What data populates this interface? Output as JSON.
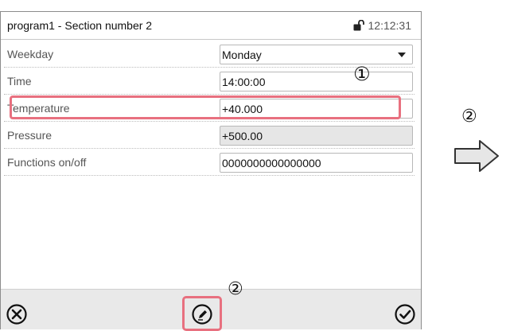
{
  "header": {
    "title": "program1 - Section number 2",
    "time": "12:12:31",
    "icons": [
      "lock-icon"
    ]
  },
  "rows": [
    {
      "label": "Weekday",
      "value": "Monday",
      "type": "select"
    },
    {
      "label": "Time",
      "value": "14:00:00",
      "type": "input"
    },
    {
      "label": "Temperature",
      "value": "+40.000",
      "type": "input"
    },
    {
      "label": "Pressure",
      "value": "+500.00",
      "type": "readonly"
    },
    {
      "label": "Functions on/off",
      "value": "0000000000000000",
      "type": "input"
    }
  ],
  "footer": {
    "icons": [
      "cancel-icon",
      "edit-pen-icon",
      "confirm-check-icon"
    ]
  },
  "annotations": {
    "marker_1": "①",
    "marker_2": "②"
  },
  "colors": {
    "highlight": "#e8707f",
    "footer_bg": "#e9e9e9",
    "readonly_bg": "#e6e6e6"
  }
}
